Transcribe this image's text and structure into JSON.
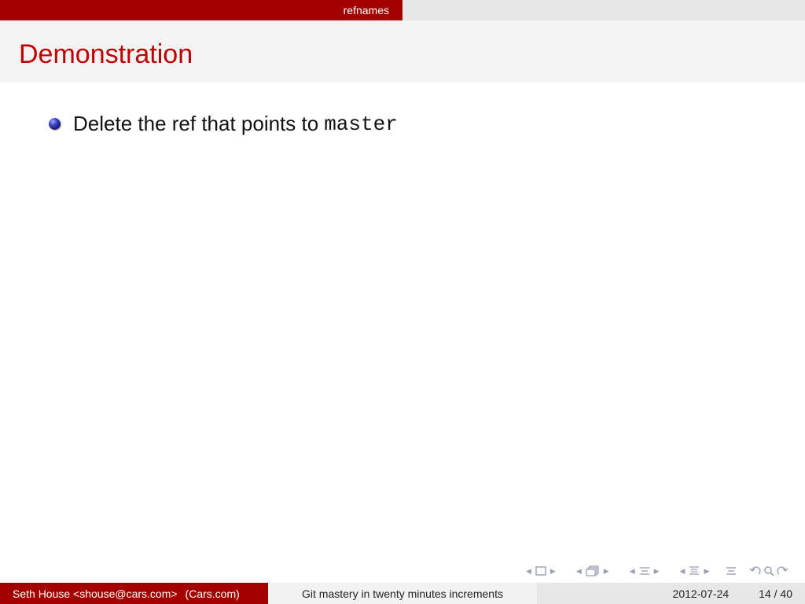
{
  "header": {
    "section": "refnames"
  },
  "frame": {
    "title": "Demonstration",
    "bullets": [
      {
        "text": "Delete the ref that points to",
        "code": "master"
      }
    ]
  },
  "footer": {
    "author": "Seth House <shouse@cars.com>",
    "institute": "(Cars.com)",
    "talk_title": "Git mastery in twenty minutes increments",
    "date": "2012-07-24",
    "page": "14 / 40"
  },
  "nav_icons": {
    "frame": "frame-nav-icon",
    "subsection": "subsection-nav-icon",
    "section": "section-nav-icon",
    "document": "document-nav-icon",
    "back": "back-nav-icon",
    "search": "search-icon",
    "forward": "forward-nav-icon"
  },
  "colors": {
    "accent": "#a50000",
    "title": "#c00000",
    "nav": "#9aa0b4"
  }
}
